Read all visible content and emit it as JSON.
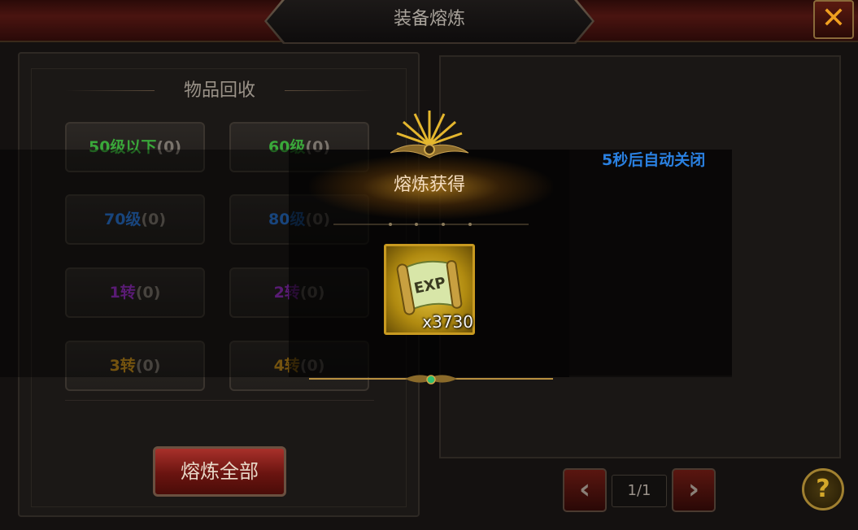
{
  "header": {
    "title": "装备熔炼",
    "close_icon": "close-icon"
  },
  "recycle": {
    "title": "物品回收",
    "buttons": [
      {
        "label": "50级以下",
        "label_color": "#3aa83a",
        "count": "(0)"
      },
      {
        "label": "60级",
        "label_color": "#3aa83a",
        "count": "(0)"
      },
      {
        "label": "70级",
        "label_color": "#2a78d8",
        "count": "(0)"
      },
      {
        "label": "80级",
        "label_color": "#2a78d8",
        "count": "(0)"
      },
      {
        "label": "1转",
        "label_color": "#9a30c8",
        "count": "(0)"
      },
      {
        "label": "2转",
        "label_color": "#9a30c8",
        "count": "(0)"
      },
      {
        "label": "3转",
        "label_color": "#c8901a",
        "count": "(0)"
      },
      {
        "label": "4转",
        "label_color": "#c8901a",
        "count": "(0)"
      }
    ],
    "count_color": "#7a746c",
    "smelt_all": "熔炼全部"
  },
  "result": {
    "title": "熔炼获得",
    "auto_close": "5秒后自动关闭",
    "item": {
      "icon": "exp-scroll-icon",
      "badge": "EXP",
      "count": "x3730"
    }
  },
  "pager": {
    "prev_icon": "arrow-left-icon",
    "next_icon": "arrow-right-icon",
    "page": "1/1"
  },
  "help": {
    "icon": "help-icon",
    "label": "?"
  }
}
